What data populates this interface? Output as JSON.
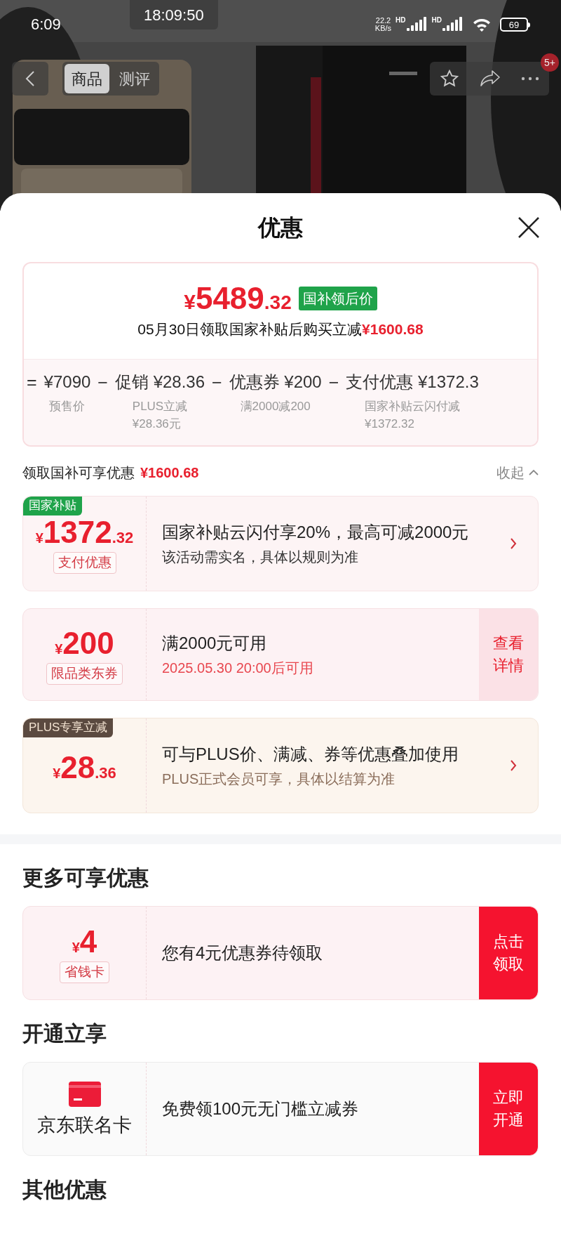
{
  "status_bar": {
    "time": "6:09",
    "clock_overlay": "18:09:50",
    "speed": [
      "22.2",
      "KB/s"
    ],
    "networks": [
      "HD",
      "HD"
    ],
    "battery": "69"
  },
  "nav": {
    "tabs": [
      {
        "label": "商品",
        "selected": true
      },
      {
        "label": "测评",
        "selected": false
      }
    ],
    "badge": "5+"
  },
  "sheet": {
    "title": "优惠",
    "summary": {
      "currency": "¥",
      "amount": "5489",
      "cents": ".32",
      "tag": "国补领后价",
      "note": "05月30日领取国家补贴后购买立减",
      "note_amount": "¥1600.68",
      "breakdown": [
        {
          "op": "=",
          "amount": "¥7090",
          "sub": [
            "预售价"
          ]
        },
        {
          "op": "−",
          "label": "促销",
          "amount": "¥28.36",
          "sub": [
            "PLUS立减",
            "¥28.36元"
          ]
        },
        {
          "op": "−",
          "label": "优惠券",
          "amount": "¥200",
          "sub": [
            "满2000减200"
          ]
        },
        {
          "op": "−",
          "label": "支付优惠",
          "amount": "¥1372.3",
          "sub": [
            "国家补贴云闪付减",
            "¥1372.32"
          ]
        }
      ]
    },
    "subsidy_header": {
      "label": "领取国补可享优惠",
      "amount": "¥1600.68",
      "toggle": "收起",
      "expanded": true
    },
    "offers": [
      {
        "kind": "subsidy",
        "tag": "国家补贴",
        "currency": "¥",
        "amount": "1372",
        "cents": ".32",
        "badge": "支付优惠",
        "title": "国家补贴云闪付享20%，最高可减2000元",
        "subtitle": "该活动需实名，具体以规则为准",
        "action": {
          "kind": "chevron"
        }
      },
      {
        "kind": "coupon",
        "currency": "¥",
        "amount": "200",
        "badge": "限品类东券",
        "title": "满2000元可用",
        "subtitle": "2025.05.30 20:00后可用",
        "action": {
          "kind": "details",
          "label": "查看详情"
        }
      },
      {
        "kind": "plus",
        "tag": "PLUS专享立减",
        "currency": "¥",
        "amount": "28",
        "cents": ".36",
        "title": "可与PLUS价、满减、券等优惠叠加使用",
        "subtitle": "PLUS正式会员可享，具体以结算为准",
        "action": {
          "kind": "chevron"
        }
      }
    ],
    "sections": [
      {
        "heading": "更多可享优惠",
        "cards": [
          {
            "kind": "coupon",
            "currency": "¥",
            "amount": "4",
            "badge": "省钱卡",
            "title": "您有4元优惠券待领取",
            "action": {
              "kind": "claim",
              "label": "点击领取"
            }
          }
        ]
      },
      {
        "heading": "开通立享",
        "cards": [
          {
            "kind": "card",
            "name": "京东联名卡",
            "title": "免费领100元无门槛立减券",
            "action": {
              "kind": "claim",
              "label": "立即开通"
            }
          }
        ]
      },
      {
        "heading": "其他优惠"
      }
    ]
  }
}
